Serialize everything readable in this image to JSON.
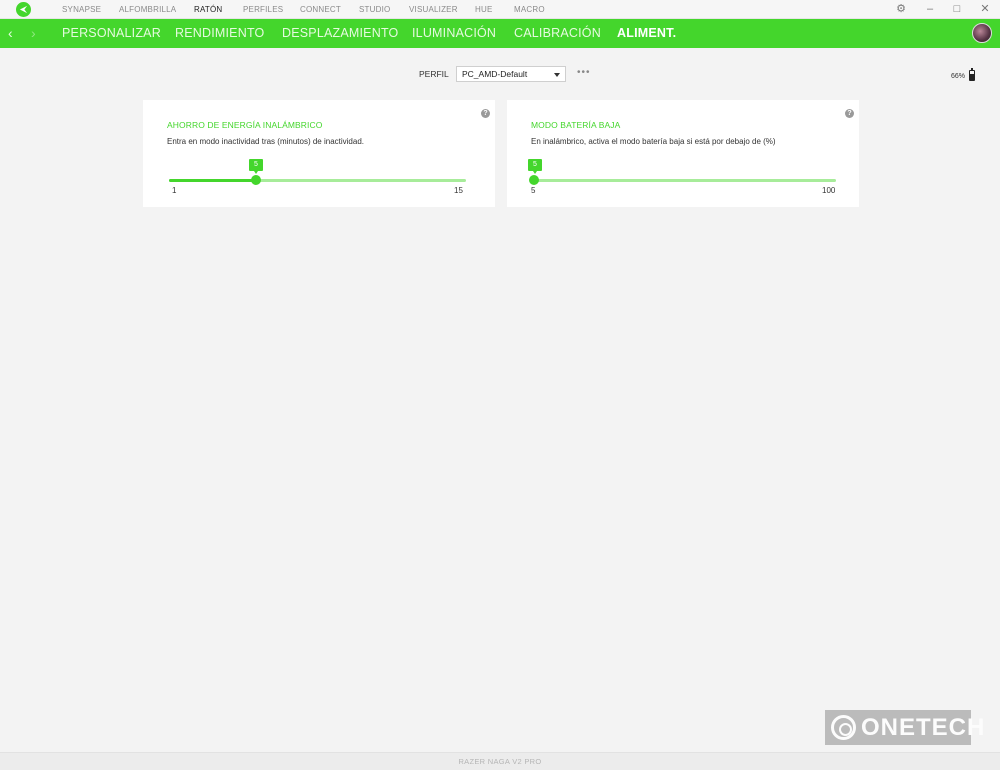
{
  "topbar": {
    "items": [
      "SYNAPSE",
      "ALFOMBRILLA",
      "RATÓN",
      "PERFILES",
      "CONNECT",
      "STUDIO",
      "VISUALIZER",
      "HUE",
      "MACRO"
    ],
    "active_index": 2,
    "icons": {
      "logo": "razer-logo-icon",
      "settings": "gear-icon",
      "minimize": "minimize-icon",
      "maximize": "maximize-icon",
      "close": "close-icon"
    }
  },
  "subnav": {
    "tabs": [
      "PERSONALIZAR",
      "RENDIMIENTO",
      "DESPLAZAMIENTO",
      "ILUMINACIÓN",
      "CALIBRACIÓN",
      "ALIMENT."
    ],
    "active_index": 5,
    "icons": {
      "back": "chevron-left-icon",
      "forward": "chevron-right-icon",
      "avatar": "user-avatar"
    }
  },
  "profile": {
    "label": "PERFIL",
    "selected": "PC_AMD-Default",
    "more_icon": "more-horizontal-icon"
  },
  "battery": {
    "percent_text": "66%",
    "level": 0.66
  },
  "cards": [
    {
      "title": "AHORRO DE ENERGÍA INALÁMBRICO",
      "description": "Entra en modo inactividad tras (minutos) de inactividad.",
      "value": "5",
      "min": "1",
      "max": "15",
      "help": "?"
    },
    {
      "title": "MODO BATERÍA BAJA",
      "description": "En inalámbrico, activa el modo batería baja si está por debajo de (%)",
      "value": "5",
      "min": "5",
      "max": "100",
      "help": "?"
    }
  ],
  "watermark": "ONETECH",
  "footer": {
    "device": "RAZER NAGA V2 PRO"
  },
  "colors": {
    "accent": "#44d62c",
    "track": "#a7ec9a",
    "background": "#f3f3f3"
  }
}
